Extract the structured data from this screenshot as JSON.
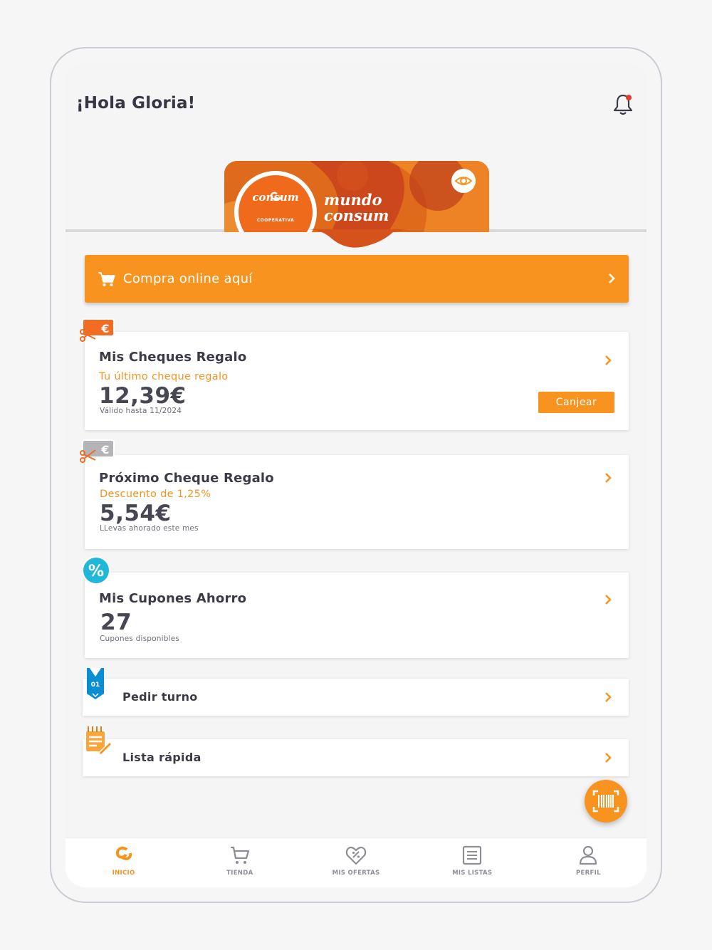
{
  "header": {
    "greeting": "¡Hola  Gloria!"
  },
  "card": {
    "logo_brand": "consum",
    "logo_sub": "COOPERATIVA",
    "title_line1": "mundo",
    "title_line2": "consum"
  },
  "cta": {
    "label": "Compra online aquí"
  },
  "gift_cheques": {
    "title": "Mis Cheques Regalo",
    "subtitle": "Tu último cheque regalo",
    "amount": "12,39€",
    "validity": "Válido hasta 11/2024",
    "redeem_label": "Canjear"
  },
  "next_cheque": {
    "title": "Próximo Cheque Regalo",
    "subtitle": "Descuento de 1,25%",
    "amount": "5,54€",
    "note": "LLevas ahorado este mes"
  },
  "coupons": {
    "title": "Mis Cupones Ahorro",
    "count": "27",
    "note": "Cupones disponibles"
  },
  "turn": {
    "label": "Pedir turno",
    "ticket_number": "01"
  },
  "quick_list": {
    "label": "Lista rápida"
  },
  "tabbar": {
    "items": [
      {
        "label": "INICIO",
        "icon": "consum-logo-icon",
        "active": true
      },
      {
        "label": "TIENDA",
        "icon": "cart-icon",
        "active": false
      },
      {
        "label": "MIS OFERTAS",
        "icon": "heart-percent-icon",
        "active": false
      },
      {
        "label": "MIS LISTAS",
        "icon": "list-icon",
        "active": false
      },
      {
        "label": "PERFIL",
        "icon": "user-icon",
        "active": false
      }
    ]
  },
  "colors": {
    "accent": "#f7931e",
    "badge_orange": "#f26c23",
    "badge_grey": "#b4b4b8",
    "percent_badge": "#20b7d8",
    "text_dark": "#3b3b47",
    "notification_dot": "#e63b2e"
  }
}
